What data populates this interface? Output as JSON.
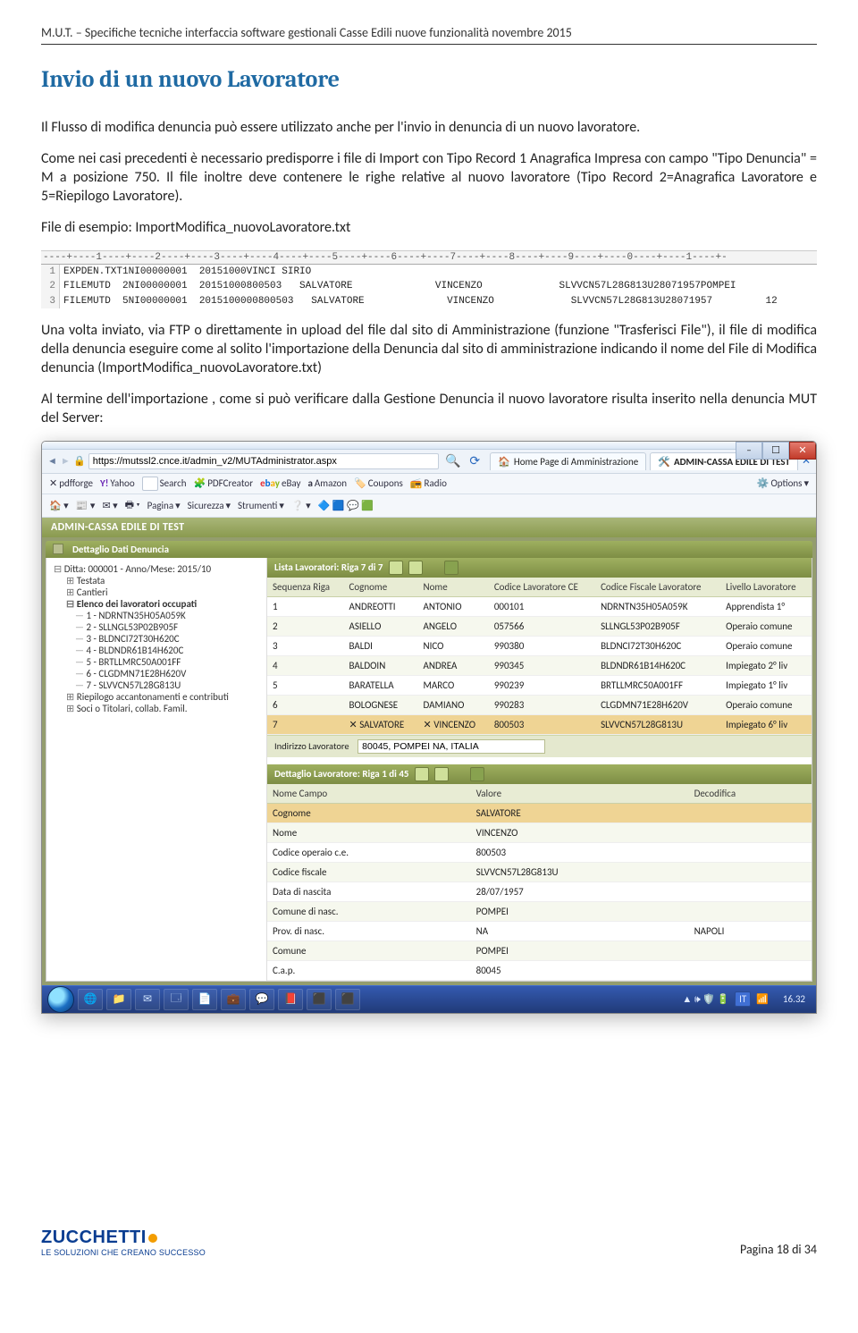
{
  "header": "M.U.T. – Specifiche tecniche interfaccia software gestionali Casse Edili nuove funzionalità novembre 2015",
  "heading": "Invio di un nuovo Lavoratore",
  "p1": "Il Flusso di modifica denuncia può essere utilizzato anche per l'invio in denuncia di un nuovo lavoratore.",
  "p2": "Come nei casi precedenti è necessario predisporre i file di Import con Tipo Record 1 Anagrafica Impresa con campo \"Tipo Denuncia\" = M a posizione 750. Il file inoltre deve contenere le righe relative al nuovo lavoratore (Tipo Record 2=Anagrafica Lavoratore e 5=Riepilogo Lavoratore).",
  "p3": "File di esempio: ImportModifica_nuovoLavoratore.txt",
  "ruler": "----+----1----+----2----+----3----+----4----+----5----+----6----+----7----+----8----+----9----+----0----+----1----+-",
  "code": [
    "EXPDEN.TXT1NI00000001  20151000VINCI SIRIO",
    "FILEMUTD  2NI00000001  20151000800503   SALVATORE              VINCENZO             SLVVCN57L28G813U28071957POMPEI",
    "FILEMUTD  5NI00000001  2015100000800503   SALVATORE              VINCENZO             SLVVCN57L28G813U28071957         12"
  ],
  "p4": "Una volta inviato, via FTP o direttamente in upload del file dal sito di Amministrazione (funzione \"Trasferisci File\"), il file di modifica della denuncia eseguire come al solito l'importazione della Denuncia dal sito di amministrazione indicando il nome del File di Modifica denuncia (ImportModifica_nuovoLavoratore.txt)",
  "p5": "Al termine dell'importazione , come si può verificare dalla Gestione Denuncia il nuovo lavoratore risulta inserito nella denuncia MUT del Server:",
  "browser": {
    "url": "https://mutssl2.cnce.it/admin_v2/MUTAdministrator.aspx",
    "tabs": [
      {
        "label": "Home Page di Amministrazione",
        "active": false
      },
      {
        "label": "ADMIN-CASSA EDILE DI TEST",
        "active": true
      }
    ],
    "favbar": [
      "pdfforge",
      "Yahoo",
      "Search",
      "PDFCreator",
      "eBay",
      "Amazon",
      "Coupons",
      "Radio",
      "Options"
    ],
    "toolbar2": [
      "Pagina",
      "Sicurezza",
      "Strumenti"
    ],
    "title_strip": "ADMIN-CASSA EDILE DI TEST",
    "panel_title": "Dettaglio Dati Denuncia",
    "tree": {
      "root": "Ditta: 000001 - Anno/Mese: 2015/10",
      "testata": "Testata",
      "cantieri": "Cantieri",
      "elenco": "Elenco dei lavoratori occupati",
      "items": [
        "1 - NDRNTN35H05A059K",
        "2 - SLLNGL53P02B905F",
        "3 - BLDNCI72T30H620C",
        "4 - BLDNDR61B14H620C",
        "5 - BRTLLMRC50A001FF",
        "6 - CLGDMN71E28H620V",
        "7 - SLVVCN57L28G813U"
      ],
      "riepilogo": "Riepilogo accantonamenti e contributi",
      "soci": "Soci o Titolari, collab. Famil."
    },
    "list_title": "Lista Lavoratori: Riga 7 di 7",
    "list_cols": [
      "Sequenza Riga",
      "Cognome",
      "Nome",
      "Codice Lavoratore CE",
      "Codice Fiscale Lavoratore",
      "Livello Lavoratore"
    ],
    "list_rows": [
      {
        "n": "1",
        "cogn": "ANDREOTTI",
        "nome": "ANTONIO",
        "cod": "000101",
        "cf": "NDRNTN35H05A059K",
        "liv": "Apprendista 1°"
      },
      {
        "n": "2",
        "cogn": "ASIELLO",
        "nome": "ANGELO",
        "cod": "057566",
        "cf": "SLLNGL53P02B905F",
        "liv": "Operaio comune"
      },
      {
        "n": "3",
        "cogn": "BALDI",
        "nome": "NICO",
        "cod": "990380",
        "cf": "BLDNCI72T30H620C",
        "liv": "Operaio comune"
      },
      {
        "n": "4",
        "cogn": "BALDOIN",
        "nome": "ANDREA",
        "cod": "990345",
        "cf": "BLDNDR61B14H620C",
        "liv": "Impiegato 2° liv"
      },
      {
        "n": "5",
        "cogn": "BARATELLA",
        "nome": "MARCO",
        "cod": "990239",
        "cf": "BRTLLMRC50A001FF",
        "liv": "Impiegato 1° liv"
      },
      {
        "n": "6",
        "cogn": "BOLOGNESE",
        "nome": "DAMIANO",
        "cod": "990283",
        "cf": "CLGDMN71E28H620V",
        "liv": "Operaio comune"
      },
      {
        "n": "7",
        "cogn": "SALVATORE",
        "nome": "VINCENZO",
        "cod": "800503",
        "cf": "SLVVCN57L28G813U",
        "liv": "Impiegato 6° liv",
        "sel": true
      }
    ],
    "indirizzo_label": "Indirizzo Lavoratore",
    "indirizzo_value": "80045, POMPEI NA, ITALIA",
    "detail_title": "Dettaglio Lavoratore: Riga 1 di 45",
    "detail_cols": [
      "Nome Campo",
      "Valore",
      "Decodifica"
    ],
    "detail_rows": [
      {
        "k": "Cognome",
        "v": "SALVATORE",
        "d": ""
      },
      {
        "k": "Nome",
        "v": "VINCENZO",
        "d": ""
      },
      {
        "k": "Codice operaio c.e.",
        "v": "800503",
        "d": ""
      },
      {
        "k": "Codice fiscale",
        "v": "SLVVCN57L28G813U",
        "d": ""
      },
      {
        "k": "Data di nascita",
        "v": "28/07/1957",
        "d": ""
      },
      {
        "k": "Comune di nasc.",
        "v": "POMPEI",
        "d": ""
      },
      {
        "k": "Prov. di nasc.",
        "v": "NA",
        "d": "NAPOLI"
      },
      {
        "k": "Comune",
        "v": "POMPEI",
        "d": ""
      },
      {
        "k": "C.a.p.",
        "v": "80045",
        "d": ""
      }
    ],
    "sys_lang": "IT",
    "sys_time": "16.32"
  },
  "footer": {
    "brand": "ZUCCHETTI",
    "tagline": "LE SOLUZIONI CHE CREANO SUCCESSO",
    "page": "Pagina 18 di 34"
  }
}
